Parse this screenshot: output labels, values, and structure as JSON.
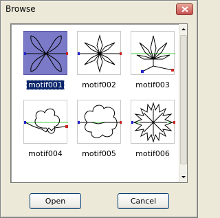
{
  "window": {
    "title": "Browse"
  },
  "items": [
    {
      "label": "motif001",
      "selected": true
    },
    {
      "label": "motif002",
      "selected": false
    },
    {
      "label": "motif003",
      "selected": false
    },
    {
      "label": "motif004",
      "selected": false
    },
    {
      "label": "motif005",
      "selected": false
    },
    {
      "label": "motif006",
      "selected": false
    }
  ],
  "buttons": {
    "open": "Open",
    "cancel": "Cancel"
  },
  "colors": {
    "selection": "#0a246a",
    "thumb_selected": "#7a7ac8",
    "guide_green": "#44cc44",
    "start_blue": "#2222cc",
    "end_red": "#cc2222"
  },
  "icons": {
    "close": "close-icon",
    "scroll_up": "scroll-up-arrow-icon",
    "scroll_down": "scroll-down-arrow-icon"
  }
}
